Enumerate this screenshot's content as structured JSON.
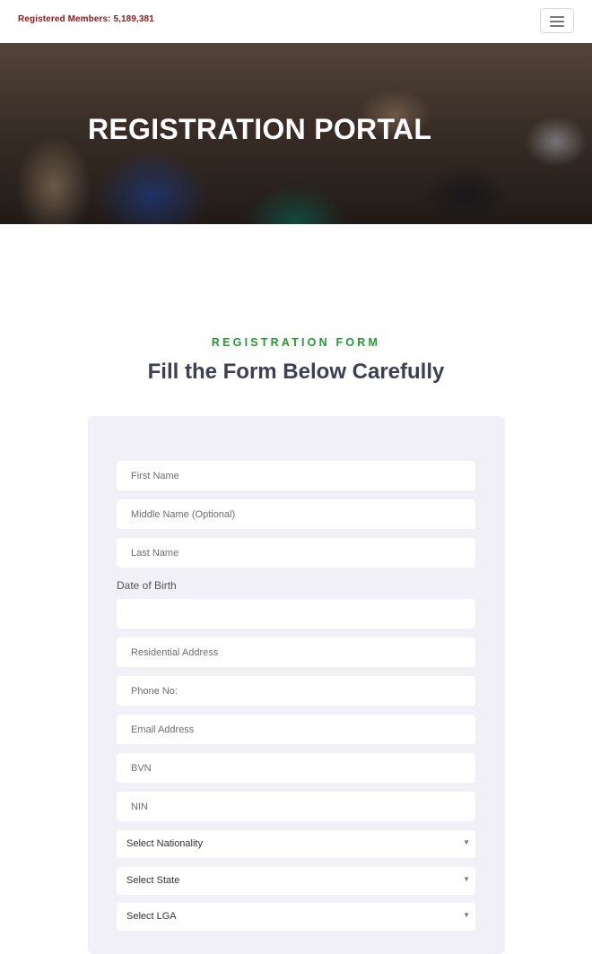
{
  "header": {
    "members_text": "Registered Members: 5,189,381"
  },
  "hero": {
    "title": "REGISTRATION PORTAL"
  },
  "section": {
    "eyebrow": "REGISTRATION FORM",
    "headline": "Fill the Form Below Carefully"
  },
  "form": {
    "first_name_placeholder": "First Name",
    "middle_name_placeholder": "Middle Name (Optional)",
    "last_name_placeholder": "Last Name",
    "dob_label": "Date of Birth",
    "dob_value": "",
    "address_placeholder": "Residential Address",
    "phone_placeholder": "Phone No:",
    "email_placeholder": "Email Address",
    "bvn_placeholder": "BVN",
    "nin_placeholder": "NIN",
    "nationality_select": "Select Nationality",
    "state_select": "Select State",
    "lga_select": "Select LGA"
  },
  "colors": {
    "members_text": "#8b1a1a",
    "eyebrow": "#1e9e2a",
    "headline": "#3e3e54",
    "form_bg": "#f1f0f6"
  },
  "icons": {
    "menu": "hamburger-icon",
    "select_caret": "caret-down-icon"
  }
}
